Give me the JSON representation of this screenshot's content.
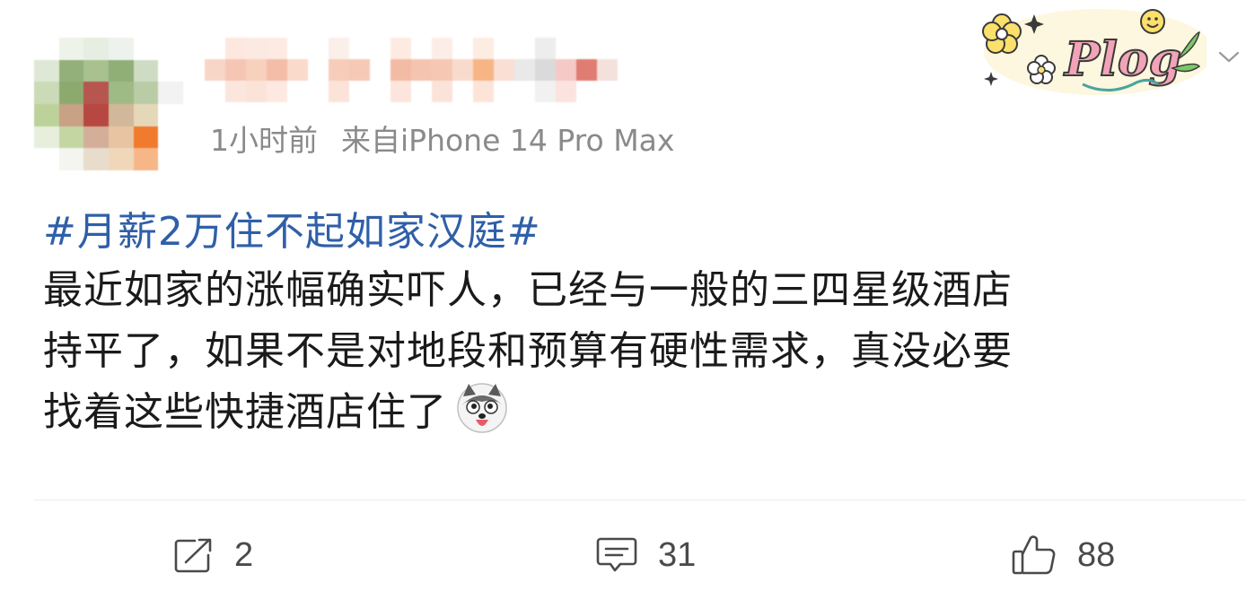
{
  "post": {
    "meta": {
      "time": "1小时前",
      "source": "来自iPhone 14 Pro Max"
    },
    "sticker_text": "Plog",
    "topic": "#月薪2万住不起如家汉庭#",
    "body_lines": [
      "最近如家的涨幅确实吓人，已经与一般的三四星级酒店",
      "持平了，如果不是对地段和预算有硬性需求，真没必要",
      "找着这些快捷酒店住了"
    ],
    "emoji": "husky-dog-emoji",
    "actions": {
      "repost": "2",
      "comment": "31",
      "like": "88"
    }
  },
  "colors": {
    "topic": "#2f5fa8",
    "meta": "#8a8a8a",
    "text": "#1a1a1a",
    "actions": "#4a4a4a"
  }
}
